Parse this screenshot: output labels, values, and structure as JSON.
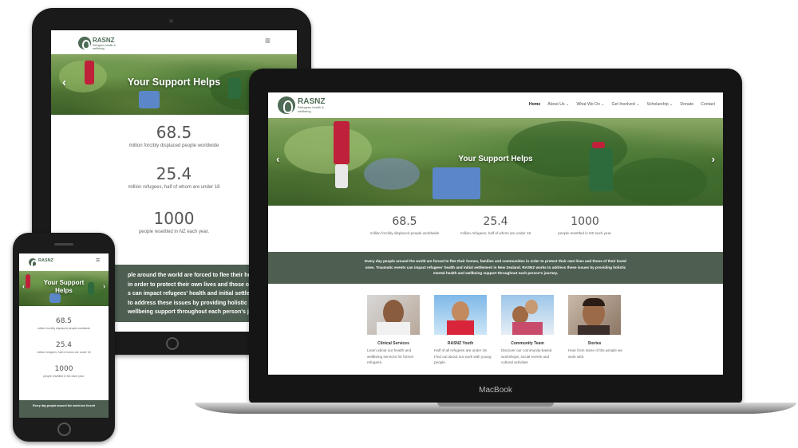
{
  "site": {
    "logo_name": "RASNZ",
    "logo_tagline": "Refugees health & wellbeing",
    "hero_title": "Your Support Helps",
    "hero_title_phone_line1": "Your Support",
    "hero_title_phone_line2": "Helps",
    "prev_arrow": "‹",
    "next_arrow": "›",
    "menu_icon": "≡",
    "stats": [
      {
        "value": "68.5",
        "label": "million forcibly displaced people worldwide"
      },
      {
        "value": "25.4",
        "label": "million refugees, half of whom are under 18"
      },
      {
        "value": "1000",
        "label": "people resettled in NZ each year."
      }
    ],
    "mission": "Every day people around the world are forced to flee their homes, families and communities in order to protect their own lives and those of their loved ones. Traumatic events can impact refugees' health and initial settlement in New Zealand. RASNZ works to address these issues by providing holistic mental health and wellbeing support throughout each person's journey.",
    "tablet_mission_lines": [
      "ple around the world are forced to flee their homes, famil",
      "in order to protect their own lives and those of their love",
      "s can impact refugees' health and initial settlement in Ne",
      "to address these issues by providing holistic mental he",
      "wellbeing support throughout each person's journey."
    ],
    "phone_mission": "Every day people around the world are forced"
  },
  "laptop": {
    "brand": "MacBook",
    "nav": [
      {
        "label": "Home",
        "active": true
      },
      {
        "label": "About Us ⌄",
        "active": false
      },
      {
        "label": "What We Do ⌄",
        "active": false
      },
      {
        "label": "Get Involved ⌄",
        "active": false
      },
      {
        "label": "Scholarship ⌄",
        "active": false
      },
      {
        "label": "Donate",
        "active": false
      },
      {
        "label": "Contact",
        "active": false
      }
    ],
    "cards": [
      {
        "title": "Clinical Services",
        "text": "Learn about our health and wellbeing services for former refugees."
      },
      {
        "title": "RASNZ Youth",
        "text": "Half of all refugees are under 18. Find out about our work with young people."
      },
      {
        "title": "Community Team",
        "text": "Discover our community-based workshops, social events and cultural activities"
      },
      {
        "title": "Stories",
        "text": "Hear from some of the people we work with."
      }
    ]
  },
  "colors": {
    "band": "#4e5f52",
    "logo": "#4e6b55"
  }
}
